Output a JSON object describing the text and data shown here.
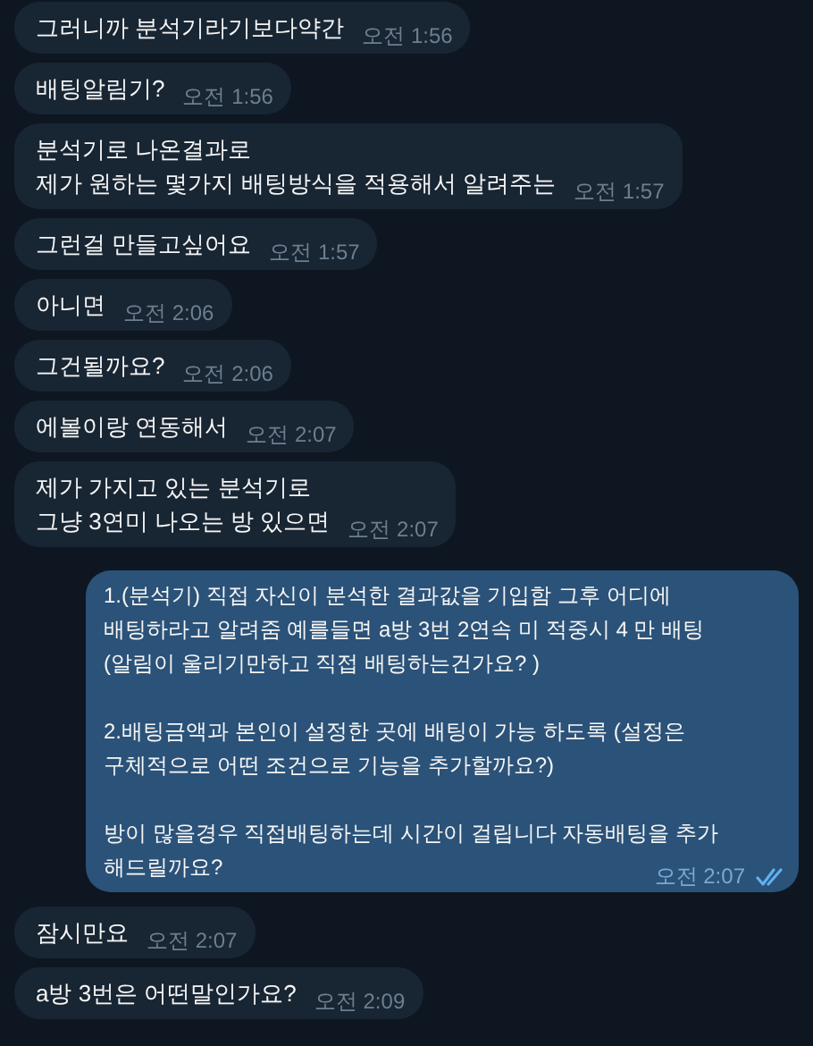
{
  "messages": [
    {
      "outgoing": false,
      "lines": [
        "그러니까 분석기라기보다약간"
      ],
      "time": "오전 1:56"
    },
    {
      "outgoing": false,
      "lines": [
        "배팅알림기?"
      ],
      "time": "오전 1:56"
    },
    {
      "outgoing": false,
      "lines": [
        "분석기로 나온결과로",
        "제가 원하는 몇가지 배팅방식을 적용해서 알려주는"
      ],
      "time": "오전 1:57"
    },
    {
      "outgoing": false,
      "lines": [
        "그런걸 만들고싶어요"
      ],
      "time": "오전 1:57"
    },
    {
      "outgoing": false,
      "lines": [
        "아니면"
      ],
      "time": "오전 2:06"
    },
    {
      "outgoing": false,
      "lines": [
        "그건될까요?"
      ],
      "time": "오전 2:06"
    },
    {
      "outgoing": false,
      "lines": [
        "에볼이랑 연동해서"
      ],
      "time": "오전 2:07"
    },
    {
      "outgoing": false,
      "lines": [
        "제가 가지고 있는 분석기로",
        "그냥 3연미 나오는 방 있으면"
      ],
      "time": "오전 2:07"
    },
    {
      "outgoing": true,
      "paragraphs": [
        [
          "1.(분석기) 직접 자신이 분석한 결과값을 기입함 그후 어디에",
          "배팅하라고 알려줌 예를들면 a방 3번 2연속 미 적중시 4 만 배팅",
          "(알림이 울리기만하고 직접 배팅하는건가요? )"
        ],
        [
          "2.배팅금액과 본인이 설정한 곳에 배팅이 가능 하도록 (설정은",
          "구체적으로 어떤 조건으로 기능을 추가할까요?)"
        ],
        [
          "방이 많을경우 직접배팅하는데 시간이 걸립니다 자동배팅을 추가",
          "해드릴까요?"
        ]
      ],
      "time": "오전 2:07",
      "read": true
    },
    {
      "outgoing": false,
      "lines": [
        "잠시만요"
      ],
      "time": "오전 2:07"
    },
    {
      "outgoing": false,
      "lines": [
        "a방 3번은 어떤말인가요?"
      ],
      "time": "오전 2:09"
    }
  ]
}
